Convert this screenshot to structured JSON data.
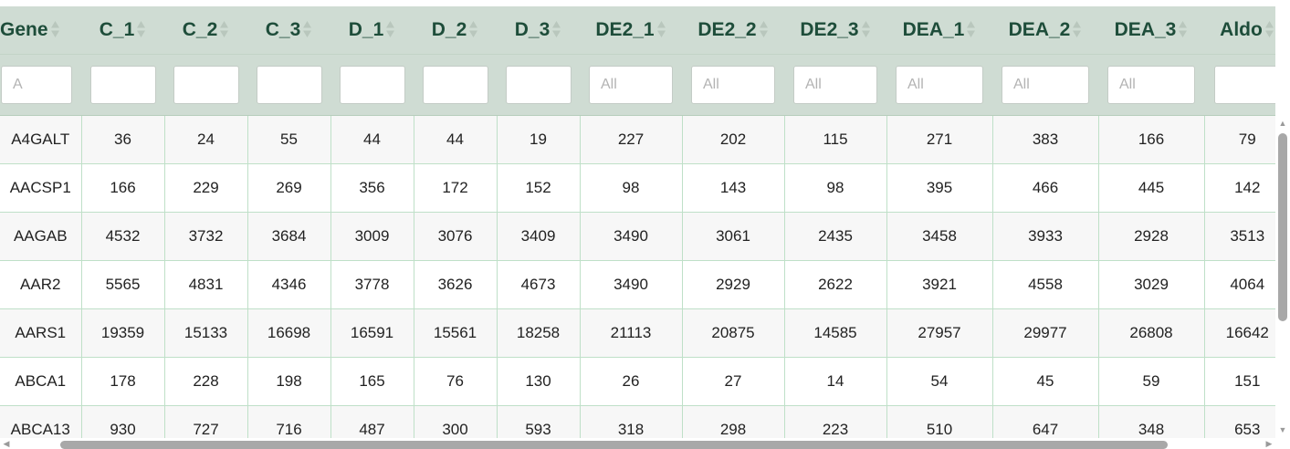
{
  "table": {
    "columns": [
      "Gene",
      "C_1",
      "C_2",
      "C_3",
      "D_1",
      "D_2",
      "D_3",
      "DE2_1",
      "DE2_2",
      "DE2_3",
      "DEA_1",
      "DEA_2",
      "DEA_3",
      "Aldo"
    ],
    "filter_placeholders": [
      "A",
      "",
      "",
      "",
      "",
      "",
      "",
      "All",
      "All",
      "All",
      "All",
      "All",
      "All",
      ""
    ],
    "rows": [
      [
        "A4GALT",
        "36",
        "24",
        "55",
        "44",
        "44",
        "19",
        "227",
        "202",
        "115",
        "271",
        "383",
        "166",
        "79"
      ],
      [
        "AACSP1",
        "166",
        "229",
        "269",
        "356",
        "172",
        "152",
        "98",
        "143",
        "98",
        "395",
        "466",
        "445",
        "142"
      ],
      [
        "AAGAB",
        "4532",
        "3732",
        "3684",
        "3009",
        "3076",
        "3409",
        "3490",
        "3061",
        "2435",
        "3458",
        "3933",
        "2928",
        "3513"
      ],
      [
        "AAR2",
        "5565",
        "4831",
        "4346",
        "3778",
        "3626",
        "4673",
        "3490",
        "2929",
        "2622",
        "3921",
        "4558",
        "3029",
        "4064"
      ],
      [
        "AARS1",
        "19359",
        "15133",
        "16698",
        "16591",
        "15561",
        "18258",
        "21113",
        "20875",
        "14585",
        "27957",
        "29977",
        "26808",
        "16642"
      ],
      [
        "ABCA1",
        "178",
        "228",
        "198",
        "165",
        "76",
        "130",
        "26",
        "27",
        "14",
        "54",
        "45",
        "59",
        "151"
      ],
      [
        "ABCA13",
        "930",
        "727",
        "716",
        "487",
        "300",
        "593",
        "318",
        "298",
        "223",
        "510",
        "647",
        "348",
        "653"
      ]
    ]
  },
  "colors": {
    "header_bg": "#cfdcd3",
    "header_text": "#1e4d3a",
    "grid_line": "#bfe0c8",
    "row_alt": "#f7f7f7"
  },
  "icons": {
    "sort": "sort-arrows-icon",
    "scroll_up": "arrow-up-icon",
    "scroll_down": "arrow-down-icon",
    "scroll_left": "arrow-left-icon",
    "scroll_right": "arrow-right-icon"
  }
}
